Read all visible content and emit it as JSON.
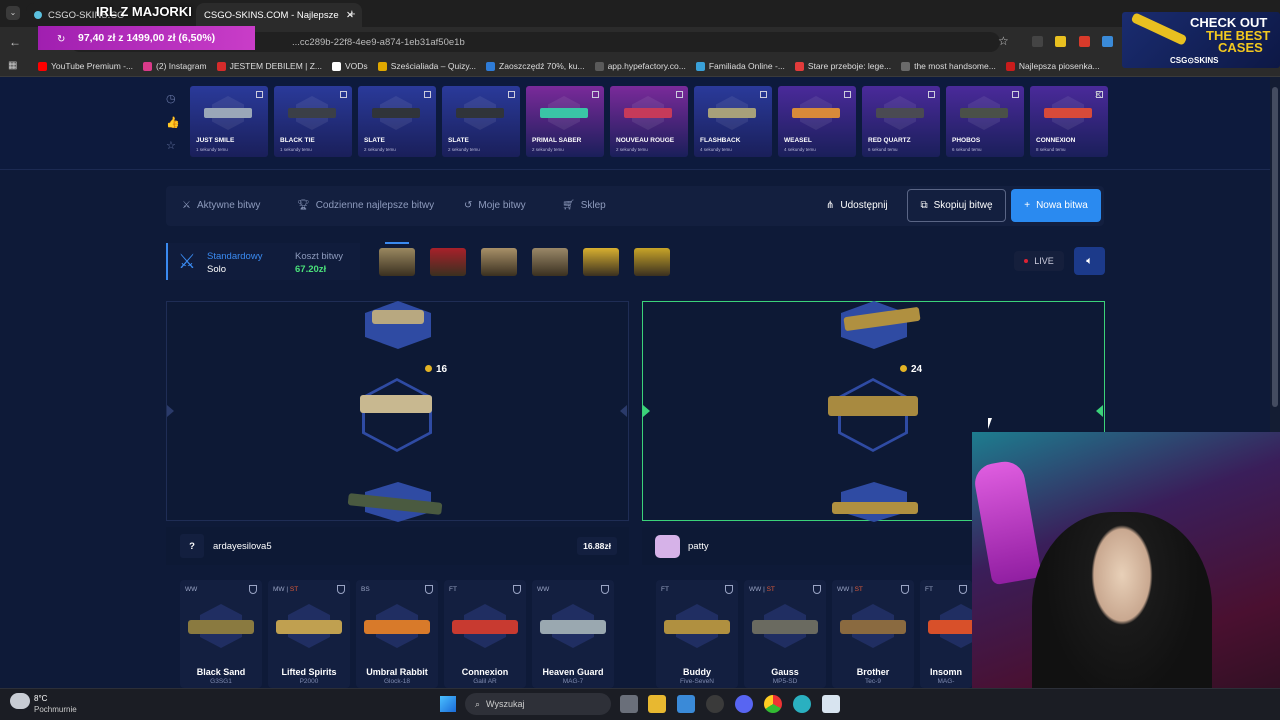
{
  "browser": {
    "tabs": [
      {
        "label": "CSGO-SKINS.CO"
      },
      {
        "label": "CSGO-SKINS.COM - Najlepsze"
      }
    ],
    "url": "...cc289b-22f8-4ee9-a874-1eb31af50e1b",
    "bookmarks": [
      "YouTube Premium -...",
      "(2) Instagram",
      "JESTEM DEBILEM | Z...",
      "VODs",
      "Sześcialiada – Quizy...",
      "Zaoszczędź 70%, ku...",
      "app.hypefactory.co...",
      "Familiada Online -...",
      "Stare przeboje: lege...",
      "the most handsome...",
      "Najlepsza piosenka..."
    ],
    "bookmark_colors": [
      "#ff0000",
      "#ff0000",
      "#d93a8a",
      "#d62b2b",
      "#ffffff",
      "#e0a800",
      "#2e7bd6",
      "#5a5a5a",
      "#39a0d8",
      "#e23b3b",
      "#6a6a6a",
      "#c91c1c"
    ]
  },
  "stream_overlay": {
    "title": "IRL Z MAJORKI",
    "goal_text": "97,40 zł z 1499,00 zł (6,50%)",
    "goal_progress": 0.065
  },
  "ad": {
    "line1": "CHECK OUT",
    "line2": "THE BEST",
    "line3": "CASES",
    "brand": "CSG⊙SKINS"
  },
  "recent_drops": [
    {
      "name": "JUST SMILE",
      "time": "1 sekundy temu",
      "bg": "#2a3a9a",
      "gun": "#9aa7b8"
    },
    {
      "name": "BLACK TIE",
      "time": "1 sekundy temu",
      "bg": "#2a3a9a",
      "gun": "#3b3f47"
    },
    {
      "name": "SLATE",
      "time": "2 sekundy temu",
      "bg": "#2a3a9a",
      "gun": "#30343a"
    },
    {
      "name": "SLATE",
      "time": "2 sekundy temu",
      "bg": "#2a3a9a",
      "gun": "#30343a"
    },
    {
      "name": "PRIMAL SABER",
      "time": "2 sekundy temu",
      "bg": "#7a2a9a",
      "gun": "#3ac5a6"
    },
    {
      "name": "NOUVEAU ROUGE",
      "time": "2 sekundy temu",
      "bg": "#7a2a9a",
      "gun": "#c63a5a"
    },
    {
      "name": "FLASHBACK",
      "time": "4 sekundy temu",
      "bg": "#2a3a9a",
      "gun": "#a7a07a"
    },
    {
      "name": "WEASEL",
      "time": "4 sekundy temu",
      "bg": "#4a2a9a",
      "gun": "#d88a3a"
    },
    {
      "name": "RED QUARTZ",
      "time": "6 sekund temu",
      "bg": "#4a2a9a",
      "gun": "#4a4a52"
    },
    {
      "name": "PHOBOS",
      "time": "6 sekund temu",
      "bg": "#4a2a9a",
      "gun": "#4a5048"
    },
    {
      "name": "CONNEXION",
      "time": "8 sekund temu",
      "bg": "#4a2a9a",
      "gun": "#d84a3a"
    }
  ],
  "nav": {
    "active": "Aktywne bitwy",
    "daily": "Codzienne najlepsze bitwy",
    "mine": "Moje bitwy",
    "shop": "Sklep",
    "share": "Udostępnij",
    "copy": "Skopiuj bitwę",
    "new": "Nowa bitwa"
  },
  "battle": {
    "mode_label": "Standardowy",
    "mode_value": "Solo",
    "cost_label": "Koszt bitwy",
    "cost_value": "67.20zł",
    "live": "LIVE",
    "case_colors": [
      "#9a8860",
      "#a8202a",
      "#a89068",
      "#9a8868",
      "#d8b030",
      "#c8a428"
    ]
  },
  "players": [
    {
      "name": "ardayesilova5",
      "avatar": "?",
      "total": "16.88zł",
      "spin_value": "16",
      "items": [
        {
          "wear": "WW",
          "st": "",
          "name": "Black Sand",
          "weapon": "G3SG1",
          "color": "#8a7a40"
        },
        {
          "wear": "MW",
          "st": "ST",
          "name": "Lifted Spirits",
          "weapon": "P2000",
          "color": "#c0a050"
        },
        {
          "wear": "BS",
          "st": "",
          "name": "Umbral Rabbit",
          "weapon": "Glock-18",
          "color": "#d87a2a"
        },
        {
          "wear": "FT",
          "st": "",
          "name": "Connexion",
          "weapon": "Galil AR",
          "color": "#c83a30"
        },
        {
          "wear": "WW",
          "st": "",
          "name": "Heaven Guard",
          "weapon": "MAG-7",
          "color": "#9aa8b0"
        }
      ]
    },
    {
      "name": "patty",
      "avatar": "",
      "total": "",
      "spin_value": "24",
      "items": [
        {
          "wear": "FT",
          "st": "",
          "name": "Buddy",
          "weapon": "Five-SeveN",
          "color": "#b09040"
        },
        {
          "wear": "WW",
          "st": "ST",
          "name": "Gauss",
          "weapon": "MP5-SD",
          "color": "#6a6a60"
        },
        {
          "wear": "WW",
          "st": "ST",
          "name": "Brother",
          "weapon": "Tec-9",
          "color": "#8a6a40"
        },
        {
          "wear": "FT",
          "st": "",
          "name": "Insomn",
          "weapon": "MAG-",
          "color": "#d8502a"
        }
      ]
    }
  ],
  "taskbar": {
    "weather_temp": "8°C",
    "weather_desc": "Pochmurnie",
    "search_placeholder": "Wyszukaj"
  }
}
